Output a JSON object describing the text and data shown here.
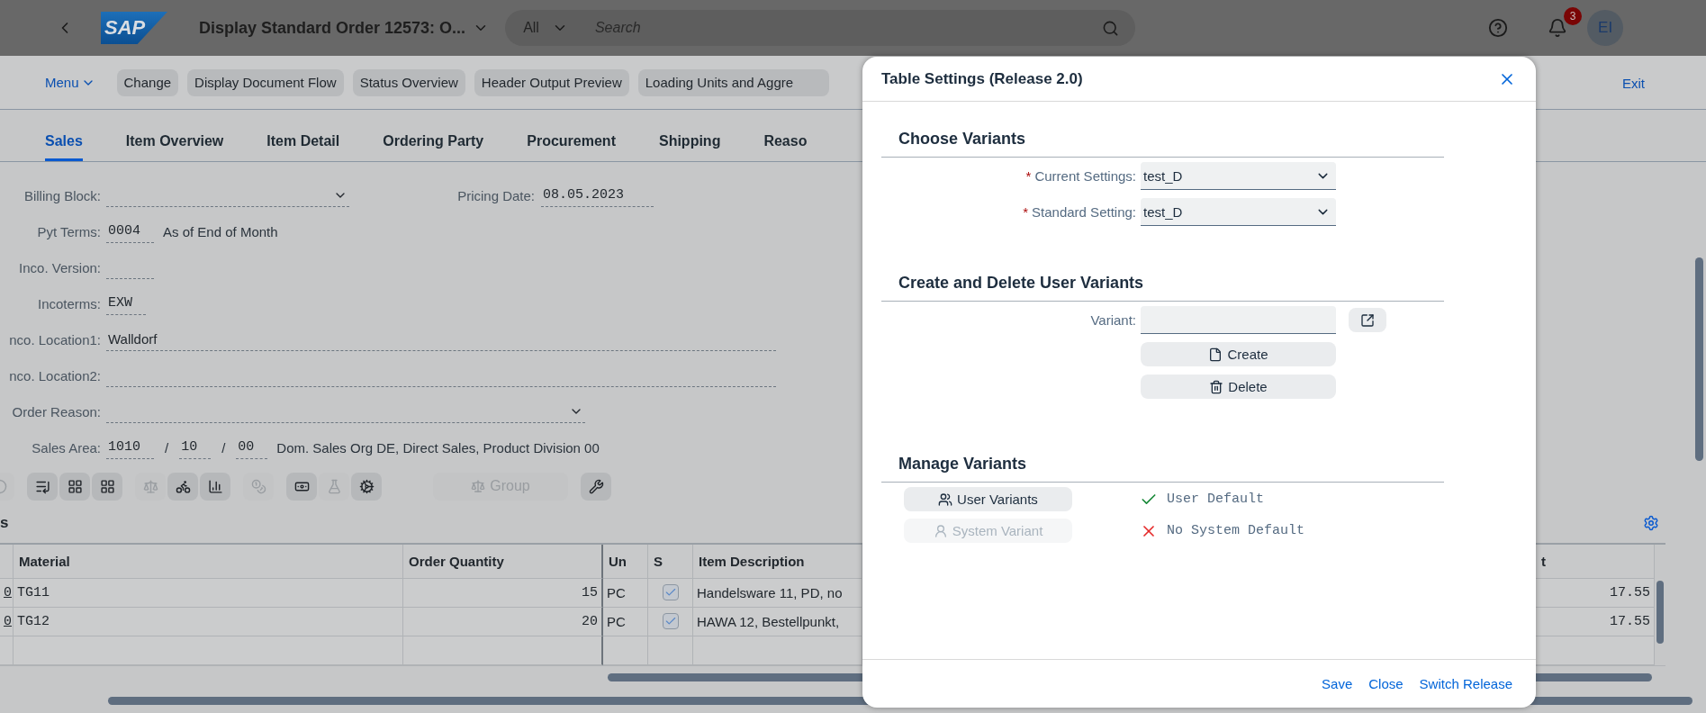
{
  "shell": {
    "logo": "SAP",
    "title": "Display Standard Order 12573: O...",
    "search": {
      "scope": "All",
      "placeholder": "Search"
    },
    "notifications": "3",
    "avatar": "EI"
  },
  "toolbar": {
    "menu": "Menu",
    "buttons": [
      "Change",
      "Display Document Flow",
      "Status Overview",
      "Header Output Preview",
      "Loading Units and Aggre"
    ],
    "exit": "Exit"
  },
  "tabs": [
    {
      "label": "Sales",
      "selected": true
    },
    {
      "label": "Item Overview",
      "selected": false
    },
    {
      "label": "Item Detail",
      "selected": false
    },
    {
      "label": "Ordering Party",
      "selected": false
    },
    {
      "label": "Procurement",
      "selected": false
    },
    {
      "label": "Shipping",
      "selected": false
    },
    {
      "label": "Reaso",
      "selected": false
    }
  ],
  "form": [
    {
      "label": "Billing Block:",
      "fields": [
        {
          "kind": "select"
        }
      ],
      "aside": {
        "label": "Pricing Date:",
        "fields": [
          {
            "kind": "date",
            "value": "08.05.2023"
          }
        ]
      }
    },
    {
      "label": "Pyt Terms:",
      "fields": [
        {
          "kind": "code",
          "value": "0004"
        },
        {
          "kind": "note",
          "value": "As of End of Month"
        }
      ]
    },
    {
      "label": "Inco. Version:",
      "fields": [
        {
          "kind": "code"
        }
      ]
    },
    {
      "label": "Incoterms:",
      "fields": [
        {
          "kind": "code",
          "value": "EXW"
        }
      ]
    },
    {
      "label": "nco. Location1:",
      "fields": [
        {
          "kind": "long",
          "value": "Walldorf"
        }
      ]
    },
    {
      "label": "nco. Location2:",
      "fields": [
        {
          "kind": "long"
        }
      ]
    },
    {
      "label": "Order Reason:",
      "fields": [
        {
          "kind": "wide-select"
        }
      ]
    },
    {
      "label": "Sales Area:",
      "fields": [
        {
          "kind": "code",
          "value": "1010"
        },
        {
          "kind": "sep",
          "value": "/"
        },
        {
          "kind": "code",
          "value": "10"
        },
        {
          "kind": "sep",
          "value": "/"
        },
        {
          "kind": "code",
          "value": "00"
        },
        {
          "kind": "note",
          "value": "Dom. Sales Org DE, Direct Sales, Product Division 00"
        }
      ]
    }
  ],
  "icon_tools": [
    {
      "disabled": true
    },
    {
      "disabled": false
    },
    {
      "disabled": false
    },
    {
      "disabled": false
    },
    {
      "disabled": true
    },
    {
      "disabled": false
    },
    {
      "disabled": false
    },
    {
      "disabled": true
    },
    {
      "disabled": false
    },
    {
      "disabled": true
    },
    {
      "disabled": false
    }
  ],
  "group_button": {
    "label": "Group",
    "disabled": true
  },
  "items": {
    "title": "s",
    "columns": [
      "Material",
      "Order Quantity",
      "Un",
      "S",
      "Item Description",
      "t"
    ],
    "rows": [
      {
        "item": "0",
        "material": "TG11",
        "quantity": "15",
        "unit": "PC",
        "s_checked": true,
        "description": "Handelsware 11, PD, no",
        "column_7": "17.55"
      },
      {
        "item": "0",
        "material": "TG12",
        "quantity": "20",
        "unit": "PC",
        "s_checked": true,
        "description": "HAWA 12, Bestellpunkt,",
        "column_7": "17.55"
      }
    ]
  },
  "dialog": {
    "title": "Table Settings (Release 2.0)",
    "sections": [
      {
        "title": "Choose Variants",
        "rows": [
          {
            "kind": "select",
            "label": "Current Settings:",
            "marker": "*",
            "value": "test_D"
          },
          {
            "kind": "select",
            "label": "Standard Setting:",
            "marker": "*",
            "value": "test_D"
          }
        ]
      },
      {
        "title": "Create and Delete User Variants",
        "rows": [
          {
            "kind": "input",
            "label": "Variant:"
          },
          {
            "kind": "button",
            "label": "Create"
          },
          {
            "kind": "button",
            "label": "Delete"
          }
        ]
      },
      {
        "title": "Manage Variants",
        "rows": [
          {
            "kind": "variant",
            "button": "User Variants",
            "disabled": false,
            "status": "User Default",
            "ok": true
          },
          {
            "kind": "variant",
            "button": "System Variant",
            "disabled": true,
            "status": "No System Default",
            "ok": false
          }
        ]
      }
    ],
    "actions": [
      "Save",
      "Close",
      "Switch Release"
    ]
  }
}
